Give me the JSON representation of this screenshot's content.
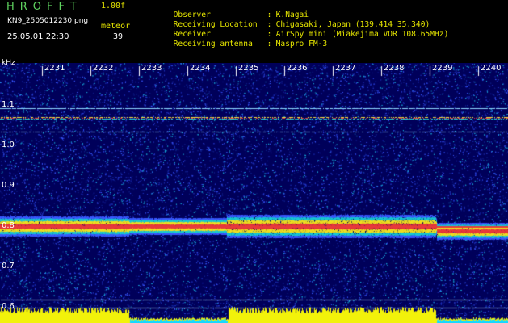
{
  "app": {
    "title": "HROFFT",
    "version": "1.00f"
  },
  "file": {
    "name": "KN9_2505012230.png",
    "timestamp": "25.05.01 22:30"
  },
  "meteor": {
    "label": "meteor",
    "count": "39"
  },
  "info": [
    {
      "key": "Observer",
      "sep": ":",
      "value": "K.Nagai"
    },
    {
      "key": "Receiving Location",
      "sep": ":",
      "value": "Chigasaki, Japan (139.414 35.340)"
    },
    {
      "key": "Receiver",
      "sep": ":",
      "value": "AirSpy mini (Miakejima VOR 108.65MHz)"
    },
    {
      "key": "Receiving antenna",
      "sep": ":",
      "value": "Maspro FM-3"
    }
  ],
  "spectrogram": {
    "unit": "kHz",
    "minute_labels": [
      "2231",
      "2232",
      "2233",
      "2234",
      "2235",
      "2236",
      "2237",
      "2238",
      "2239",
      "2240"
    ],
    "freq_labels": [
      "1.1",
      "1.0",
      "0.9",
      "0.8",
      "0.7",
      "0.6"
    ],
    "colors": {
      "background": "#00005a",
      "noise": "#2a3ad8",
      "trace_low": "#17c9d1",
      "trace_mid": "#f0e020",
      "trace_high": "#e83a3a",
      "power_bar": "#f2f20a",
      "power_bar_low": "#16d8ff"
    }
  }
}
